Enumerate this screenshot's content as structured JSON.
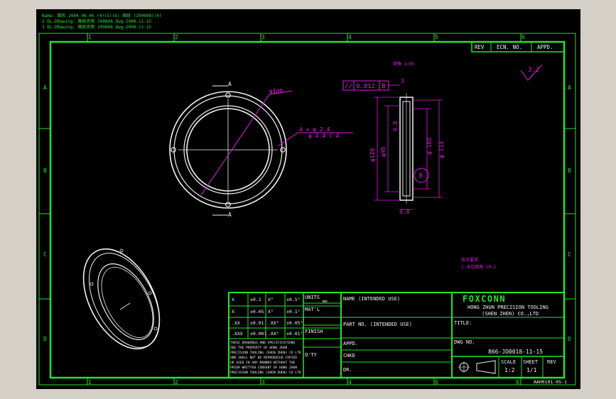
{
  "notes": {
    "line1": "Name: 图名 2004-06-06 (4)(5)(6) 图纸 (200608)(4)",
    "line2": "2 DL-DRawing: 图纸名称 200608 Dwg-2008-11-15",
    "line3": "3 DL-DRawing: 图纸名称 200608 Dwg-2008-11-15"
  },
  "zones": {
    "cols": [
      "1",
      "2",
      "3",
      "4",
      "5",
      "6"
    ],
    "rows": [
      "A",
      "B",
      "C",
      "D"
    ]
  },
  "revision_block": {
    "rev": "REV",
    "ecn": "ECN. NO.",
    "appd": "APPD."
  },
  "front_view": {
    "section_mark": "A",
    "diameter_108": "φ108",
    "hole_note_1": "4 × φ 2.4",
    "hole_note_2": "φ 4.4 ▽ 4"
  },
  "side_view": {
    "tolerance_symbol": "//",
    "tolerance_value": "0.012",
    "datum": "B",
    "top_dim": "3",
    "chamfer": "0.8",
    "d120": "φ120",
    "d95": "φ95",
    "d102": "φ 102",
    "d114": "φ 114",
    "datum_circle": "B",
    "bottom_dim": "9.8",
    "note_top": "倒角 1×45"
  },
  "roughness": "3.2",
  "tech_notes": {
    "line1": "技术要求",
    "line2": "1.未注倒角 C0.1"
  },
  "tolerance_table": {
    "rows": [
      [
        "X",
        "±0.1",
        "X°",
        "±0.5°"
      ],
      [
        "X",
        "±0.05",
        "X°",
        "±0.1°"
      ],
      [
        ".XX",
        "±0.01",
        ".XX°",
        "±0.05°"
      ],
      [
        ".XXX",
        "±0.001",
        ".XX°",
        "±0.01°"
      ]
    ],
    "units": "UNITS",
    "units_val": "mm",
    "matl": "MAT'L",
    "finish": "FINISH",
    "qty": "Q'TY",
    "legal": [
      "THESE DRAWINGS AND SPECIFICATIONS",
      "ARE THE PROPERTY OF HONG ZHUN",
      "PRECISION TOOLING (SHEN ZHEN) CO LTD",
      "AND SHALL NOT BE REPRODUCED COPIED",
      "OR USED IN ANY MANNER WITHOUT THE",
      "PRIOR WRITTEN CONSENT OF HONG ZHUN",
      "PRECISION TOOLING (SHEN ZHEN) CO LTD"
    ]
  },
  "title_block": {
    "name": "NAME (INTENDED USE)",
    "part_no": "PART NO. (INTENDED USE)",
    "appd": "APPD.",
    "chkd": "CHKD",
    "dr": "DR.",
    "logo": "FOXCONN",
    "company1": "HONG ZHUN PRECISION TOOLING",
    "company2": "(SHEN ZHEN) CO.,LTD",
    "title": "TITLE:",
    "dwg_no_label": "DWG NO.",
    "dwg_no": "866-JD0018-11-15",
    "scale_label": "SCALE",
    "scale": "1:2",
    "sheet_label": "SHEET",
    "sheet": "1/1",
    "rev_label": "REV"
  },
  "corner_id": "AAH0101-05-1"
}
